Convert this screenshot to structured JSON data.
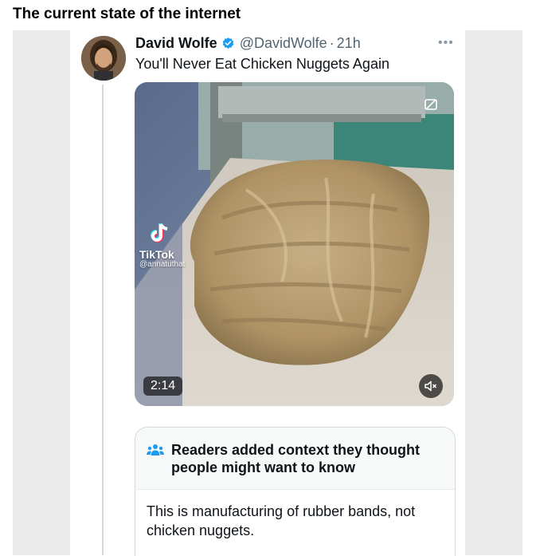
{
  "page": {
    "heading": "The current state of the internet"
  },
  "tweet": {
    "author_name": "David Wolfe",
    "handle": "@DavidWolfe",
    "separator": "·",
    "time": "21h",
    "more": "•••",
    "text": "You'll Never Eat Chicken Nuggets Again",
    "verified_color": "#1d9bf0",
    "icons": [
      "verified-badge-icon",
      "more-options-icon",
      "tiktok-logo-icon",
      "mute-icon",
      "people-icon"
    ]
  },
  "media": {
    "tiktok_label": "TikTok",
    "tiktok_user": "@annatuthat",
    "duration": "2:14"
  },
  "community_note": {
    "title": "Readers added context they thought people might want to know",
    "body": "This is manufacturing of rubber bands, not chicken nuggets.",
    "accent_color": "#1d9bf0"
  }
}
